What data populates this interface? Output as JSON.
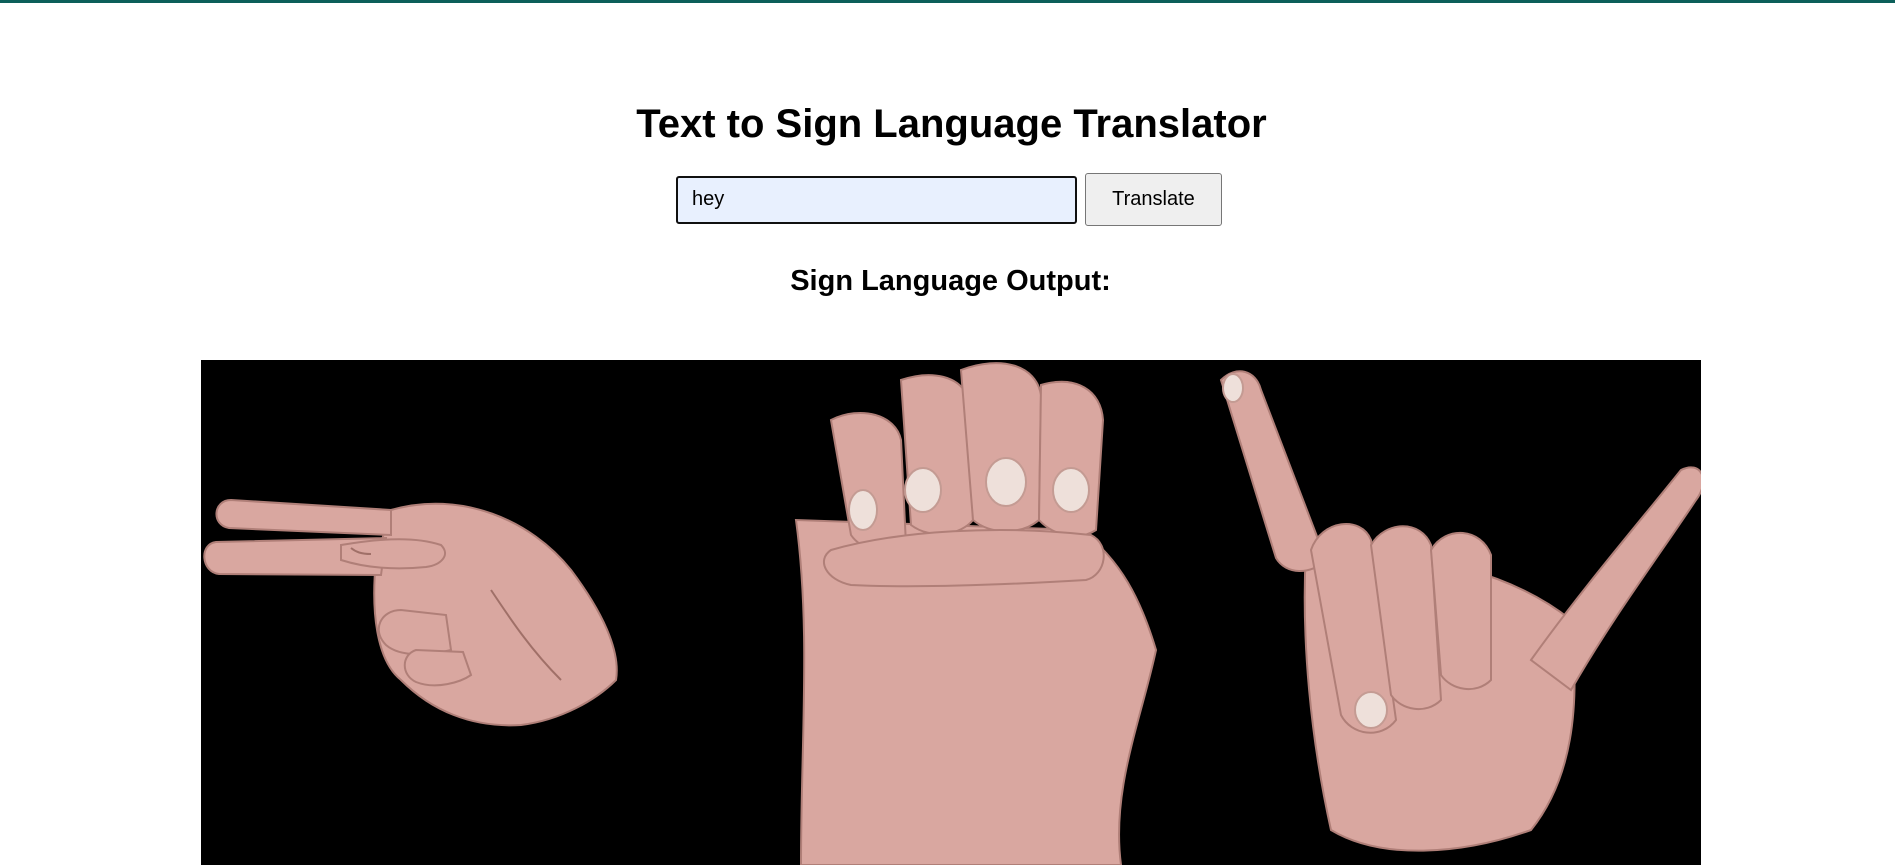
{
  "app": {
    "title": "Text to Sign Language Translator",
    "accent_color": "#0c5f5a"
  },
  "form": {
    "input_value": "hey",
    "input_placeholder": "",
    "translate_label": "Translate"
  },
  "output": {
    "heading": "Sign Language Output:",
    "signs": [
      {
        "letter": "h",
        "icon": "hand-sign-h-icon"
      },
      {
        "letter": "e",
        "icon": "hand-sign-e-icon"
      },
      {
        "letter": "y",
        "icon": "hand-sign-y-icon"
      }
    ],
    "background_color": "#000000",
    "skin_color": "#d9a7a0"
  }
}
